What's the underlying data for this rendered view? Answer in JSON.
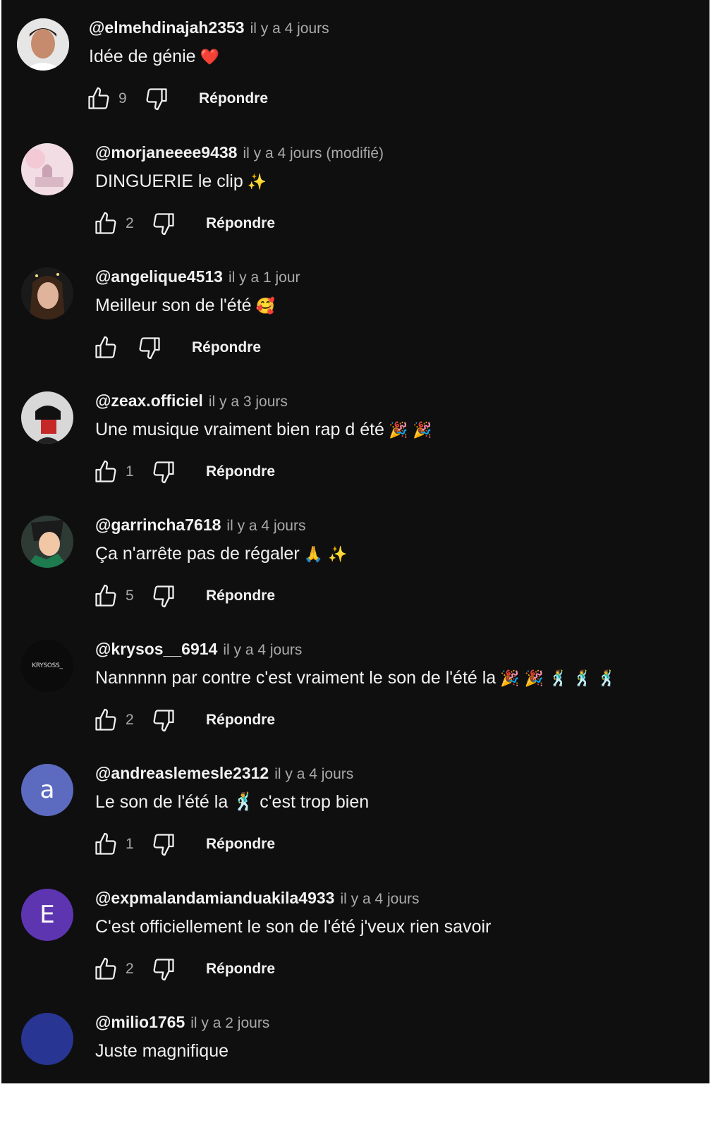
{
  "ui": {
    "reply_label": "Répondre"
  },
  "comments": [
    {
      "author": "@elmehdinajah2353",
      "time": "il y a 4 jours",
      "text": "Idée de génie",
      "emoji": "❤️",
      "likes": "9",
      "avatar": "photo"
    },
    {
      "author": "@morjaneeee9438",
      "time": "il y a 4 jours (modifié)",
      "text": "DINGUERIE le clip",
      "emoji": "✨",
      "likes": "2",
      "avatar": "photo"
    },
    {
      "author": "@angelique4513",
      "time": "il y a 1 jour",
      "text": "Meilleur son de l'été",
      "emoji": "🥰",
      "likes": "",
      "avatar": "photo"
    },
    {
      "author": "@zeax.officiel",
      "time": "il y a 3 jours",
      "text": "Une musique vraiment bien rap d été",
      "emoji": "🎉 🎉",
      "likes": "1",
      "avatar": "photo"
    },
    {
      "author": "@garrincha7618",
      "time": "il y a 4 jours",
      "text": "Ça n'arrête pas de régaler",
      "emoji": "🙏 ✨",
      "likes": "5",
      "avatar": "photo"
    },
    {
      "author": "@krysos__6914",
      "time": "il y a 4 jours",
      "text": "Nannnnn par contre c'est vraiment le son de l'été la",
      "emoji": "🎉 🎉 🕺 🕺 🕺",
      "likes": "2",
      "avatar": "logo",
      "avatar_text": "KRYSOSS_"
    },
    {
      "author": "@andreaslemesle2312",
      "time": "il y a 4 jours",
      "text": "Le son de l'été la 🕺 c'est trop bien",
      "emoji": "",
      "likes": "1",
      "avatar": "letter",
      "avatar_text": "a"
    },
    {
      "author": "@expmalandamianduakila4933",
      "time": "il y a 4 jours",
      "text": "C'est officiellement le son de l'été j'veux rien savoir",
      "emoji": "",
      "likes": "2",
      "avatar": "letter",
      "avatar_text": "E"
    },
    {
      "author": "@milio1765",
      "time": "il y a 2 jours",
      "text": "Juste magnifique",
      "emoji": "",
      "likes": "",
      "avatar": "plain"
    }
  ],
  "colors": {
    "background": "#0f0f0f",
    "text_primary": "#f1f1f1",
    "text_secondary": "#aaaaaa",
    "avatar_a": "#5c6bc0",
    "avatar_e": "#5e35b1",
    "avatar_milio": "#283593"
  },
  "icons": {
    "like": "thumb-up-icon",
    "dislike": "thumb-down-icon"
  }
}
